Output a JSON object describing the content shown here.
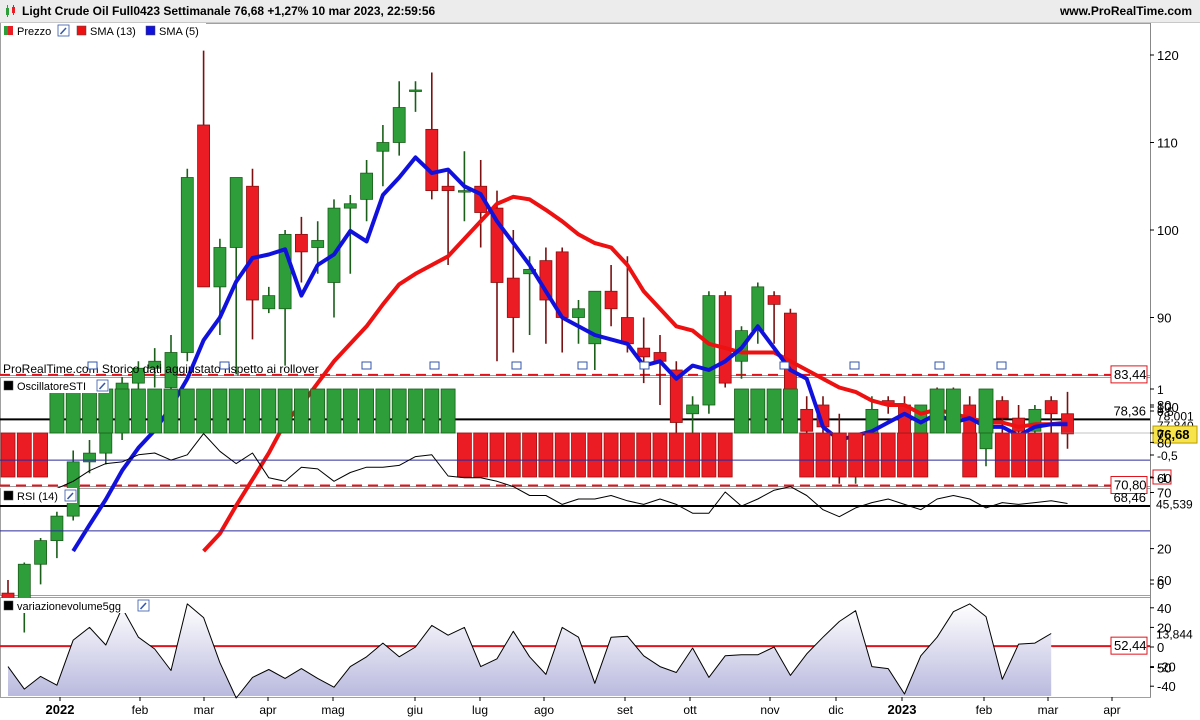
{
  "header": {
    "title": "Light Crude Oil Full0423 Settimanale 76,68 +1,27% 10 mar 2023, 22:59:56",
    "brand": "www.ProRealTime.com"
  },
  "colors": {
    "up": "#2e9e3a",
    "down": "#ec1c24",
    "sma13": "#ee1111",
    "sma5": "#1111dd",
    "rsi_area": "#b8b8de"
  },
  "price_panel": {
    "legend": [
      "Prezzo",
      "SMA (13)",
      "SMA (5)"
    ],
    "note": "ProRealTime.com Storico dati aggiustato rispetto ai rollover",
    "y_ticks": [
      "120",
      "110",
      "100",
      "90",
      "80",
      "70",
      "60",
      "50"
    ],
    "hlines": [
      {
        "value": 83.44,
        "label": "83,44",
        "style": "red-dashed"
      },
      {
        "value": 78.36,
        "label": "78,36",
        "style": "black"
      },
      {
        "value": 70.8,
        "label": "70,80",
        "style": "red-dashed"
      },
      {
        "value": 68.46,
        "label": "68,46",
        "style": "black"
      },
      {
        "value": 52.44,
        "label": "52,44",
        "style": "red"
      }
    ],
    "sma13_label": "78,001",
    "sma5_label": "77,840",
    "last_price_label": "76,68"
  },
  "sti_panel": {
    "legend": "OscillatoreSTI",
    "y_ticks": [
      "1",
      "0,5",
      "0",
      "-0,5",
      "-1"
    ]
  },
  "rsi_panel": {
    "legend": "RSI (14)",
    "y_ticks": [
      "100",
      "80",
      "60",
      "20",
      "0"
    ],
    "last_label": "45,539",
    "levels": [
      70,
      30
    ]
  },
  "vol_panel": {
    "legend": "variazionevolume5gg",
    "y_ticks": [
      "40",
      "20",
      "0",
      "-20",
      "-40"
    ],
    "last_label": "13,844"
  },
  "x_axis": {
    "labels": [
      {
        "t": "2022",
        "bold": true
      },
      {
        "t": "feb"
      },
      {
        "t": "mar"
      },
      {
        "t": "apr"
      },
      {
        "t": "mag"
      },
      {
        "t": "giu"
      },
      {
        "t": "lug"
      },
      {
        "t": "ago"
      },
      {
        "t": "set"
      },
      {
        "t": "ott"
      },
      {
        "t": "nov"
      },
      {
        "t": "dic"
      },
      {
        "t": "2023",
        "bold": true
      },
      {
        "t": "feb"
      },
      {
        "t": "mar"
      },
      {
        "t": "apr"
      }
    ]
  },
  "chart_data": {
    "type": "candlestick",
    "title": "Light Crude Oil Full0423 Settimanale",
    "timeframe": "weekly",
    "x_start": "2021-12-27",
    "x_end": "2023-03-06",
    "candles": [
      [
        58.5,
        60.0,
        57.5,
        57.5
      ],
      [
        57.5,
        62.0,
        54.0,
        61.8
      ],
      [
        61.8,
        64.8,
        59.5,
        64.5
      ],
      [
        64.5,
        67.8,
        62.5,
        67.3
      ],
      [
        67.3,
        74.8,
        66.8,
        73.5
      ],
      [
        73.5,
        76.0,
        72.2,
        74.5
      ],
      [
        74.5,
        77.5,
        73.2,
        76.8
      ],
      [
        76.8,
        83.2,
        76.0,
        82.5
      ],
      [
        82.5,
        85.0,
        80.8,
        84.2
      ],
      [
        84.2,
        86.5,
        82.0,
        85.0
      ],
      [
        82.0,
        88.0,
        78.5,
        86.0
      ],
      [
        86.0,
        107.0,
        85.0,
        106.0
      ],
      [
        112.0,
        120.5,
        93.5,
        93.5
      ],
      [
        93.5,
        99.0,
        88.0,
        98.0
      ],
      [
        98.0,
        100.0,
        83.5,
        106.0
      ],
      [
        105.0,
        107.0,
        87.5,
        92.0
      ],
      [
        91.0,
        93.5,
        90.5,
        92.5
      ],
      [
        91.0,
        100.0,
        84.5,
        99.5
      ],
      [
        99.5,
        101.5,
        94.0,
        97.5
      ],
      [
        98.0,
        101.0,
        95.0,
        98.8
      ],
      [
        94.0,
        103.5,
        90.0,
        102.5
      ],
      [
        102.5,
        104.0,
        95.0,
        103.0
      ],
      [
        103.5,
        108.0,
        101.0,
        106.5
      ],
      [
        109.0,
        112.0,
        105.0,
        110.0
      ],
      [
        110.0,
        117.0,
        108.5,
        114.0
      ],
      [
        116.0,
        117.0,
        113.5,
        116.0
      ],
      [
        111.5,
        118.0,
        103.5,
        104.5
      ],
      [
        105.0,
        107.0,
        96.0,
        104.5
      ],
      [
        104.5,
        109.0,
        101.0,
        104.5
      ],
      [
        105.0,
        108.0,
        98.0,
        102.0
      ],
      [
        102.5,
        104.5,
        85.0,
        94.0
      ],
      [
        94.5,
        100.0,
        86.0,
        90.0
      ],
      [
        95.0,
        97.0,
        88.0,
        95.5
      ],
      [
        96.5,
        98.0,
        87.0,
        92.0
      ],
      [
        97.5,
        98.0,
        86.0,
        90.0
      ],
      [
        90.0,
        92.0,
        87.0,
        91.0
      ],
      [
        87.0,
        90.0,
        84.0,
        93.0
      ],
      [
        93.0,
        96.0,
        89.0,
        91.0
      ],
      [
        90.0,
        97.0,
        86.0,
        87.0
      ],
      [
        86.5,
        90.0,
        82.5,
        85.5
      ],
      [
        86.0,
        88.0,
        80.0,
        85.0
      ],
      [
        84.0,
        85.0,
        76.5,
        78.0
      ],
      [
        79.0,
        81.0,
        74.5,
        80.0
      ],
      [
        80.0,
        93.0,
        79.0,
        92.5
      ],
      [
        92.5,
        93.0,
        82.0,
        82.5
      ],
      [
        85.0,
        89.0,
        83.0,
        88.5
      ],
      [
        88.5,
        94.0,
        87.0,
        93.5
      ],
      [
        92.5,
        93.0,
        87.0,
        91.5
      ],
      [
        90.5,
        91.0,
        79.0,
        79.5
      ],
      [
        79.5,
        81.0,
        75.0,
        77.0
      ],
      [
        80.0,
        81.0,
        76.0,
        77.5
      ],
      [
        76.5,
        79.0,
        71.0,
        72.0
      ],
      [
        72.0,
        76.0,
        71.0,
        74.5
      ],
      [
        75.5,
        81.0,
        75.0,
        79.5
      ],
      [
        80.5,
        81.0,
        79.0,
        80.0
      ],
      [
        80.0,
        81.0,
        74.0,
        75.0
      ],
      [
        74.5,
        80.0,
        73.0,
        80.0
      ],
      [
        80.0,
        82.0,
        77.0,
        79.0
      ],
      [
        80.5,
        82.0,
        78.0,
        79.5
      ],
      [
        80.0,
        81.0,
        73.0,
        74.5
      ],
      [
        75.0,
        80.5,
        73.0,
        80.0
      ],
      [
        80.5,
        81.0,
        76.0,
        78.5
      ],
      [
        78.5,
        80.0,
        73.0,
        77.0
      ],
      [
        77.0,
        80.0,
        76.0,
        79.5
      ],
      [
        80.5,
        81.0,
        75.0,
        79.0
      ],
      [
        79.0,
        81.5,
        75.0,
        76.7
      ]
    ],
    "sma5": [
      null,
      null,
      null,
      null,
      63.3,
      66.3,
      69.2,
      72.5,
      75.1,
      77.1,
      79.8,
      83.0,
      87.4,
      90.0,
      94.1,
      96.8,
      97.2,
      97.8,
      92.5,
      96.0,
      97.2,
      99.9,
      98.7,
      104.0,
      106.0,
      108.3,
      106.5,
      106.9,
      105.0,
      104.1,
      101.0,
      98.5,
      96.0,
      93.0,
      90.0,
      89.0,
      88.0,
      87.5,
      87.0,
      84.5,
      85.0,
      83.0,
      84.5,
      84.0,
      85.0,
      86.5,
      89.0,
      86.5,
      84.0,
      83.0,
      77.5,
      76.0,
      76.5,
      77.0,
      78.0,
      79.0,
      78.0,
      79.0,
      78.0,
      78.5,
      77.5,
      77.5,
      76.5,
      77.5,
      77.8,
      77.8
    ],
    "sma13": [
      null,
      null,
      null,
      null,
      null,
      null,
      null,
      null,
      null,
      null,
      null,
      null,
      63.3,
      65.3,
      68.5,
      71.5,
      74.5,
      78.0,
      80.0,
      82.5,
      85.0,
      87.0,
      89.0,
      91.5,
      93.8,
      95.0,
      96.0,
      97.0,
      99.0,
      101.0,
      103.0,
      103.8,
      103.5,
      102.3,
      101.0,
      99.5,
      98.5,
      98.0,
      96.0,
      93.0,
      91.0,
      89.0,
      88.5,
      87.0,
      86.5,
      86.0,
      86.0,
      86.0,
      85.0,
      84.0,
      83.0,
      82.0,
      81.5,
      80.5,
      80.0,
      80.0,
      79.0,
      79.5,
      79.0,
      78.5,
      78.0,
      78.0,
      77.5,
      77.8,
      77.8,
      78.0
    ],
    "sti": [
      -1,
      -1,
      -1,
      1,
      1,
      1,
      1,
      1,
      1,
      1,
      1,
      1,
      1,
      1,
      1,
      1,
      1,
      1,
      1,
      1,
      1,
      1,
      1,
      1,
      1,
      1,
      1,
      1,
      -1,
      -1,
      -1,
      -1,
      -1,
      -1,
      -1,
      -1,
      -1,
      -1,
      -1,
      -1,
      -1,
      -1,
      -1,
      -1,
      -1,
      1,
      1,
      1,
      1,
      -1,
      -1,
      -1,
      -1,
      -1,
      -1,
      -1,
      -1,
      1,
      1,
      -1,
      1,
      -1,
      -1,
      -1,
      -1
    ],
    "rsi": [
      48,
      46,
      51,
      54,
      58,
      64,
      68,
      69,
      73,
      74,
      70,
      73,
      85,
      75,
      68,
      74,
      60,
      58,
      66,
      65,
      58,
      63,
      66,
      66,
      67,
      72,
      73,
      61,
      60,
      60,
      58,
      55,
      50,
      50,
      45,
      48,
      48,
      50,
      47,
      45,
      48,
      45,
      40,
      40,
      52,
      44,
      48,
      53,
      55,
      50,
      42,
      38,
      43,
      46,
      48,
      45,
      42,
      48,
      50,
      48,
      43,
      46,
      45,
      46,
      47,
      45.5
    ],
    "vol": [
      -20,
      -43,
      -30,
      -39,
      7,
      20,
      2,
      40,
      10,
      -2,
      -24,
      44,
      30,
      -16,
      -52,
      -31,
      -23,
      -32,
      -22,
      -32,
      -41,
      -20,
      -10,
      4,
      -10,
      0,
      22,
      12,
      20,
      -20,
      -12,
      16,
      -10,
      -28,
      20,
      10,
      -37,
      10,
      11,
      -9,
      -20,
      -26,
      -1,
      -31,
      -9,
      -8,
      -8,
      0,
      -29,
      -7,
      10,
      26,
      37,
      -20,
      -22,
      -48,
      -9,
      10,
      36,
      44,
      31,
      -33,
      3,
      4,
      13.8
    ],
    "y_price_range": [
      47,
      127
    ],
    "y_sti_range": [
      -1.2,
      1.2
    ],
    "y_rsi_range": [
      0,
      100
    ],
    "y_vol_range": [
      -50,
      50
    ]
  }
}
